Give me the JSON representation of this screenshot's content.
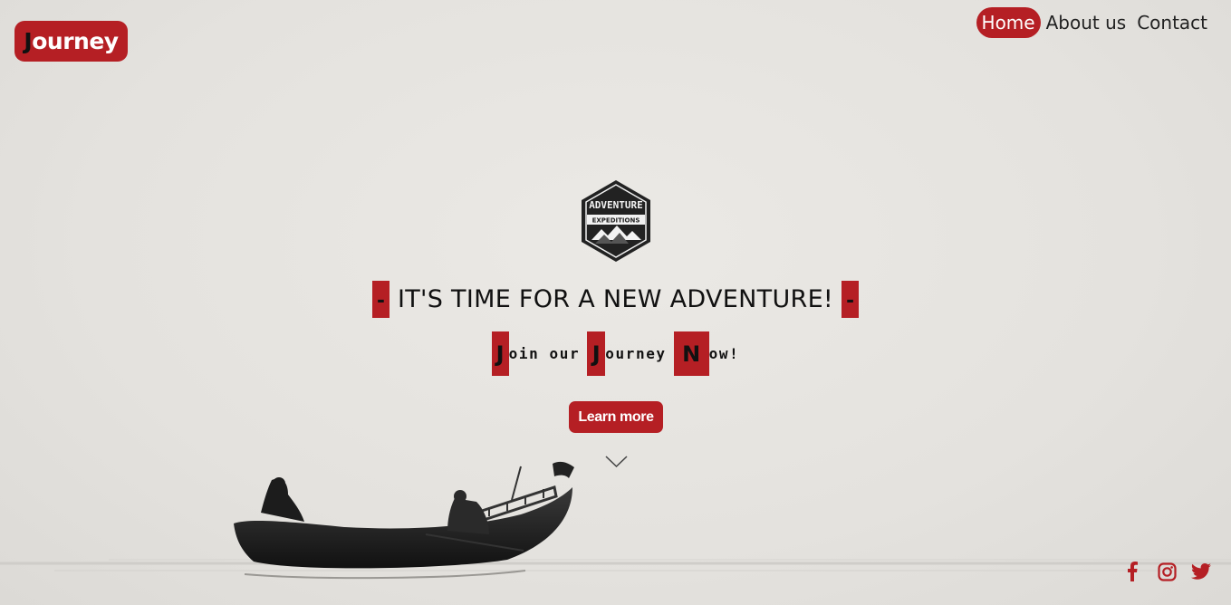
{
  "brand": {
    "first_letter": "J",
    "rest": "ourney"
  },
  "nav": {
    "items": [
      {
        "label": "Home",
        "active": true
      },
      {
        "label": "About us",
        "active": false
      },
      {
        "label": "Contact",
        "active": false
      }
    ]
  },
  "hero": {
    "badge": {
      "top": "ADVENTURE",
      "bottom": "EXPEDITIONS"
    },
    "headline_dash_left": "-",
    "headline": "IT'S TIME FOR A NEW ADVENTURE!",
    "headline_dash_right": "-",
    "subline": [
      {
        "cap": "J",
        "rest": "oin our"
      },
      {
        "cap": "J",
        "rest": "ourney"
      },
      {
        "cap": "N",
        "rest": "ow!"
      }
    ],
    "cta_label": "Learn more"
  },
  "social": [
    "facebook-icon",
    "instagram-icon",
    "twitter-icon"
  ],
  "colors": {
    "accent": "#b51f24",
    "background": "#e4e2de",
    "text": "#111111"
  }
}
